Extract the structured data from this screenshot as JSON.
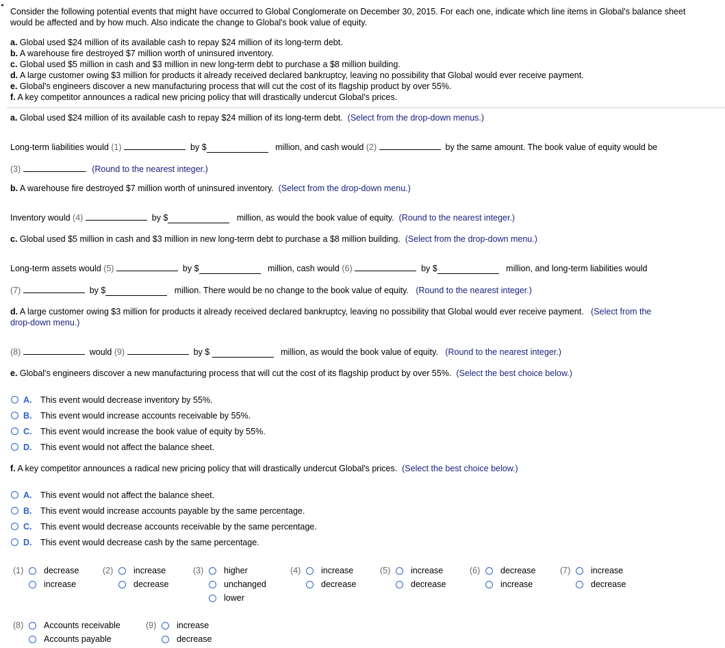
{
  "intro": {
    "line1": "Consider the following potential events that might have occurred to Global Conglomerate on December 30, 2015. For each one, indicate which line items in Global's balance sheet",
    "line2": "would be affected and by how much. Also indicate the change to Global's book value of equity."
  },
  "events": [
    {
      "letter": "a.",
      "text": "Global used $24 million of its available cash to repay $24 million of its long-term debt."
    },
    {
      "letter": "b.",
      "text": "A warehouse fire destroyed $7 million worth of uninsured inventory."
    },
    {
      "letter": "c.",
      "text": "Global used $5 million in cash and $3 million in new long-term debt to purchase a $8 million building."
    },
    {
      "letter": "d.",
      "text": "A large customer owing $3 million for products it already received declared bankruptcy, leaving no possibility that Global would ever receive payment."
    },
    {
      "letter": "e.",
      "text": "Global's engineers discover a new manufacturing process that will cut the cost of its flagship product by over 55%."
    },
    {
      "letter": "f.",
      "text": "A key competitor announces a radical new pricing policy that will drastically undercut Global's prices."
    }
  ],
  "hints": {
    "menus": "(Select from the drop-down menus.)",
    "menu": "(Select from the drop-down menu.)",
    "round": "(Round to the nearest integer.)",
    "best": "(Select the best choice below.)",
    "d_part1": "(Select from the",
    "d_part2": "drop-down menu.)"
  },
  "partA": {
    "t1": "Long-term liabilities would",
    "n1": "(1)",
    "t2": "by $",
    "t3": "million, and cash would",
    "n2": "(2)",
    "t4": "by the same amount.  The book value of equity would be",
    "n3": "(3)",
    "t5": "."
  },
  "partB": {
    "t1": "Inventory would",
    "n4": "(4)",
    "t2": "by $",
    "t3": "million, as would the book value of equity."
  },
  "partC": {
    "t1": "Long-term assets would",
    "n5": "(5)",
    "t2": "by $",
    "t3": "million, cash would",
    "n6": "(6)",
    "t4": "by $",
    "t5": "million, and long-term liabilities would",
    "n7": "(7)",
    "t6": "by $",
    "t7": "million.  There would be no change to the book value of equity."
  },
  "partD": {
    "n8": "(8)",
    "t1": "would",
    "n9": "(9)",
    "t2": "by $",
    "t3": "million, as would the book value of equity."
  },
  "partE": {
    "choices": [
      {
        "letter": "A.",
        "text": "This event would decrease inventory by 55%."
      },
      {
        "letter": "B.",
        "text": "This event would increase accounts receivable by 55%."
      },
      {
        "letter": "C.",
        "text": "This event would increase the book value of equity by 55%."
      },
      {
        "letter": "D.",
        "text": "This event would not affect the balance sheet."
      }
    ]
  },
  "partF": {
    "choices": [
      {
        "letter": "A.",
        "text": "This event would not affect the balance sheet."
      },
      {
        "letter": "B.",
        "text": "This event would increase accounts payable by the same percentage."
      },
      {
        "letter": "C.",
        "text": "This event would decrease accounts receivable by the same percentage."
      },
      {
        "letter": "D.",
        "text": "This event would decrease cash by the same percentage."
      }
    ]
  },
  "dropdown_options": [
    {
      "num": "(1)",
      "options": [
        "decrease",
        "increase"
      ]
    },
    {
      "num": "(2)",
      "options": [
        "increase",
        "decrease"
      ]
    },
    {
      "num": "(3)",
      "options": [
        "higher",
        "unchanged",
        "lower"
      ]
    },
    {
      "num": "(4)",
      "options": [
        "increase",
        "decrease"
      ]
    },
    {
      "num": "(5)",
      "options": [
        "increase",
        "decrease"
      ]
    },
    {
      "num": "(6)",
      "options": [
        "decrease",
        "increase"
      ]
    },
    {
      "num": "(7)",
      "options": [
        "increase",
        "decrease"
      ]
    },
    {
      "num": "(8)",
      "options": [
        "Accounts receivable",
        "Accounts payable"
      ]
    },
    {
      "num": "(9)",
      "options": [
        "increase",
        "decrease"
      ]
    }
  ],
  "colors": {
    "hint": "#1a237e",
    "radio": "#2b64c9",
    "number_label": "#666666",
    "divider": "#c9d3dc"
  }
}
